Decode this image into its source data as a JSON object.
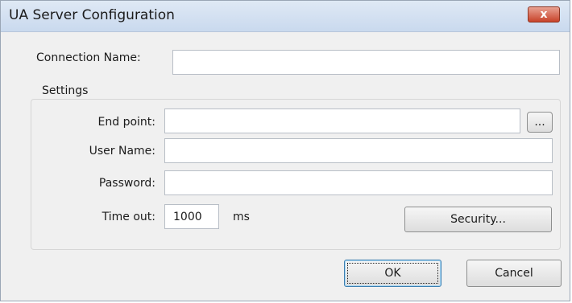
{
  "window": {
    "title": "UA Server Configuration",
    "close_glyph": "x"
  },
  "connection": {
    "label": "Connection Name:",
    "value": ""
  },
  "settings": {
    "title": "Settings",
    "endpoint": {
      "label": "End point:",
      "value": "",
      "browse_label": "..."
    },
    "username": {
      "label": "User Name:",
      "value": ""
    },
    "password": {
      "label": "Password:",
      "value": ""
    },
    "timeout": {
      "label": "Time out:",
      "value": "1000",
      "unit": "ms"
    },
    "security_button": "Security..."
  },
  "footer": {
    "ok": "OK",
    "cancel": "Cancel"
  }
}
